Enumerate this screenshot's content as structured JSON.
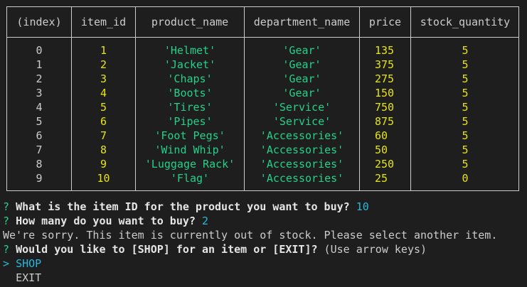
{
  "table": {
    "headers": [
      "(index)",
      "item_id",
      "product_name",
      "department_name",
      "price",
      "stock_quantity"
    ],
    "rows": [
      {
        "index": "0",
        "item_id": "1",
        "product_name": "'Helmet'",
        "department_name": "'Gear'",
        "price": "135",
        "stock_quantity": "5"
      },
      {
        "index": "1",
        "item_id": "2",
        "product_name": "'Jacket'",
        "department_name": "'Gear'",
        "price": "375",
        "stock_quantity": "5"
      },
      {
        "index": "2",
        "item_id": "3",
        "product_name": "'Chaps'",
        "department_name": "'Gear'",
        "price": "275",
        "stock_quantity": "5"
      },
      {
        "index": "3",
        "item_id": "4",
        "product_name": "'Boots'",
        "department_name": "'Gear'",
        "price": "150",
        "stock_quantity": "5"
      },
      {
        "index": "4",
        "item_id": "5",
        "product_name": "'Tires'",
        "department_name": "'Service'",
        "price": "750",
        "stock_quantity": "5"
      },
      {
        "index": "5",
        "item_id": "6",
        "product_name": "'Pipes'",
        "department_name": "'Service'",
        "price": "875",
        "stock_quantity": "5"
      },
      {
        "index": "6",
        "item_id": "7",
        "product_name": "'Foot Pegs'",
        "department_name": "'Accessories'",
        "price": "60",
        "stock_quantity": "5"
      },
      {
        "index": "7",
        "item_id": "8",
        "product_name": "'Wind Whip'",
        "department_name": "'Accessories'",
        "price": "50",
        "stock_quantity": "5"
      },
      {
        "index": "8",
        "item_id": "9",
        "product_name": "'Luggage Rack'",
        "department_name": "'Accessories'",
        "price": "250",
        "stock_quantity": "5"
      },
      {
        "index": "9",
        "item_id": "10",
        "product_name": "'Flag'",
        "department_name": "'Accessories'",
        "price": "25",
        "stock_quantity": "0"
      }
    ]
  },
  "prompts": {
    "mark": "?",
    "q1": "What is the item ID for the product you want to buy?",
    "a1": "10",
    "q2": "How many do you want to buy?",
    "a2": "2",
    "message": "We're sorry. This item is currently out of stock. Please select another item.",
    "q3": "Would you like to [SHOP] for an item or [EXIT]?",
    "q3_hint": "(Use arrow keys)",
    "pointer": ">",
    "choices": [
      "SHOP",
      "EXIT"
    ]
  },
  "colors": {
    "background": "#1e1e1e",
    "yellow": "#e5e510",
    "green": "#23d18b",
    "cyan": "#29b8db"
  }
}
